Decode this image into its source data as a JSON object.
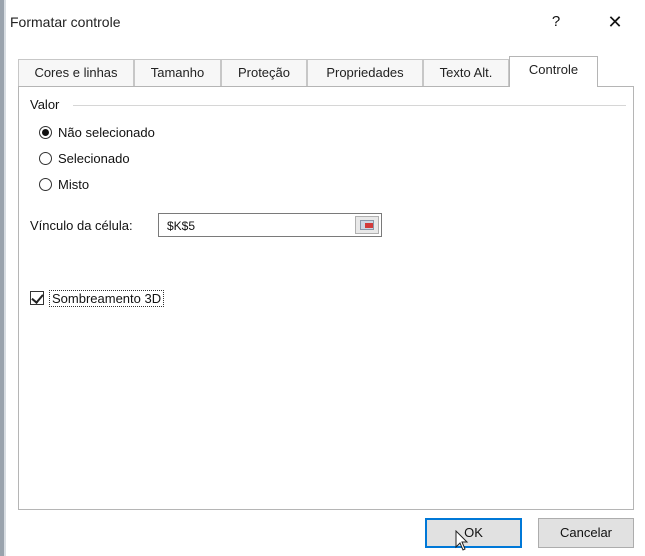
{
  "dialog": {
    "title": "Formatar controle",
    "help_glyph": "?",
    "close_glyph": "✕"
  },
  "tabs": [
    {
      "label": "Cores e linhas",
      "active": false
    },
    {
      "label": "Tamanho",
      "active": false
    },
    {
      "label": "Proteção",
      "active": false
    },
    {
      "label": "Propriedades",
      "active": false
    },
    {
      "label": "Texto Alt.",
      "active": false
    },
    {
      "label": "Controle",
      "active": true
    }
  ],
  "value_group": {
    "label": "Valor",
    "options": [
      {
        "label": "Não selecionado",
        "selected": true
      },
      {
        "label": "Selecionado",
        "selected": false
      },
      {
        "label": "Misto",
        "selected": false
      }
    ]
  },
  "cell_link": {
    "label": "Vínculo da célula:",
    "value": "$K$5"
  },
  "shading": {
    "label": "Sombreamento 3D",
    "checked": true
  },
  "buttons": {
    "ok": "OK",
    "cancel": "Cancelar"
  },
  "colors": {
    "accent": "#0078d7"
  },
  "icons": {
    "range_picker": "range-select-icon",
    "cursor": "mouse-cursor-icon"
  }
}
